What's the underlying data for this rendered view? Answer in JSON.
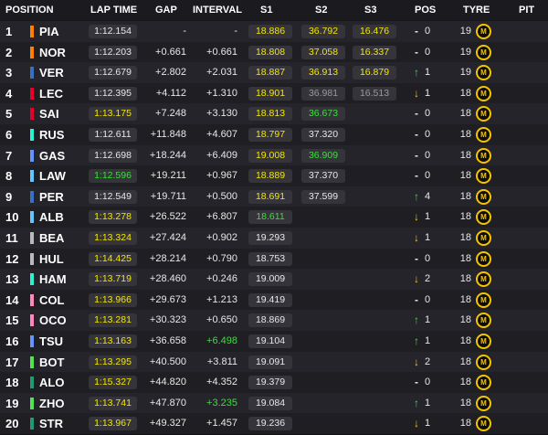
{
  "header": {
    "position": "POSITION",
    "lap_time": "LAP TIME",
    "gap": "GAP",
    "interval": "INTERVAL",
    "s1": "S1",
    "s2": "S2",
    "s3": "S3",
    "pos": "POS",
    "tyre": "TYRE",
    "pit": "PIT"
  },
  "colors": {
    "mclaren": "#ff8000",
    "redbull": "#3671c6",
    "ferrari": "#e8002d",
    "mercedes": "#27f4d2",
    "alpine": "#ff87bc",
    "williams": "#64c4ff",
    "haas": "#b6babd",
    "rb": "#6692ff",
    "sauber": "#52e252",
    "aston": "#229971",
    "personal_best": "#f5e600",
    "overall_best": "#38e038",
    "tyre_medium": "#f5c400"
  },
  "rows": [
    {
      "pos": "1",
      "team": "mclaren",
      "driver": "PIA",
      "lap": "1:12.154",
      "lap_c": "white",
      "gap": "-",
      "interval": "-",
      "int_c": "white",
      "s1": "18.886",
      "s1_c": "yellow",
      "s2": "36.792",
      "s2_c": "yellow",
      "s3": "16.476",
      "s3_c": "yellow",
      "arrow": "",
      "change": "0",
      "tyre_age": "19",
      "tyre": "M"
    },
    {
      "pos": "2",
      "team": "mclaren",
      "driver": "NOR",
      "lap": "1:12.203",
      "lap_c": "white",
      "gap": "+0.661",
      "interval": "+0.661",
      "int_c": "white",
      "s1": "18.808",
      "s1_c": "yellow",
      "s2": "37.058",
      "s2_c": "yellow",
      "s3": "16.337",
      "s3_c": "yellow",
      "arrow": "",
      "change": "0",
      "tyre_age": "19",
      "tyre": "M"
    },
    {
      "pos": "3",
      "team": "redbull",
      "driver": "VER",
      "lap": "1:12.679",
      "lap_c": "white",
      "gap": "+2.802",
      "interval": "+2.031",
      "int_c": "white",
      "s1": "18.887",
      "s1_c": "yellow",
      "s2": "36.913",
      "s2_c": "yellow",
      "s3": "16.879",
      "s3_c": "yellow",
      "arrow": "up",
      "change": "1",
      "tyre_age": "19",
      "tyre": "M"
    },
    {
      "pos": "4",
      "team": "ferrari",
      "driver": "LEC",
      "lap": "1:12.395",
      "lap_c": "white",
      "gap": "+4.112",
      "interval": "+1.310",
      "int_c": "white",
      "s1": "18.901",
      "s1_c": "yellow",
      "s2": "36.981",
      "s2_c": "gray",
      "s3": "16.513",
      "s3_c": "gray",
      "arrow": "down",
      "change": "1",
      "tyre_age": "18",
      "tyre": "M"
    },
    {
      "pos": "5",
      "team": "ferrari",
      "driver": "SAI",
      "lap": "1:13.175",
      "lap_c": "yellow",
      "gap": "+7.248",
      "interval": "+3.130",
      "int_c": "white",
      "s1": "18.813",
      "s1_c": "yellow",
      "s2": "36.673",
      "s2_c": "green",
      "s3": "",
      "s3_c": "gray",
      "arrow": "",
      "change": "0",
      "tyre_age": "18",
      "tyre": "M"
    },
    {
      "pos": "6",
      "team": "mercedes",
      "driver": "RUS",
      "lap": "1:12.611",
      "lap_c": "white",
      "gap": "+11.848",
      "interval": "+4.607",
      "int_c": "white",
      "s1": "18.797",
      "s1_c": "yellow",
      "s2": "37.320",
      "s2_c": "white",
      "s3": "",
      "s3_c": "gray",
      "arrow": "",
      "change": "0",
      "tyre_age": "18",
      "tyre": "M"
    },
    {
      "pos": "7",
      "team": "rb",
      "driver": "GAS",
      "lap": "1:12.698",
      "lap_c": "white",
      "gap": "+18.244",
      "interval": "+6.409",
      "int_c": "white",
      "s1": "19.008",
      "s1_c": "yellow",
      "s2": "36.909",
      "s2_c": "green",
      "s3": "",
      "s3_c": "gray",
      "arrow": "",
      "change": "0",
      "tyre_age": "18",
      "tyre": "M"
    },
    {
      "pos": "8",
      "team": "williams",
      "driver": "LAW",
      "lap": "1:12.596",
      "lap_c": "green",
      "gap": "+19.211",
      "interval": "+0.967",
      "int_c": "white",
      "s1": "18.889",
      "s1_c": "yellow",
      "s2": "37.370",
      "s2_c": "white",
      "s3": "",
      "s3_c": "gray",
      "arrow": "",
      "change": "0",
      "tyre_age": "18",
      "tyre": "M"
    },
    {
      "pos": "9",
      "team": "redbull",
      "driver": "PER",
      "lap": "1:12.549",
      "lap_c": "white",
      "gap": "+19.711",
      "interval": "+0.500",
      "int_c": "white",
      "s1": "18.691",
      "s1_c": "yellow",
      "s2": "37.599",
      "s2_c": "white",
      "s3": "",
      "s3_c": "gray",
      "arrow": "up",
      "change": "4",
      "tyre_age": "18",
      "tyre": "M"
    },
    {
      "pos": "10",
      "team": "williams",
      "driver": "ALB",
      "lap": "1:13.278",
      "lap_c": "yellow",
      "gap": "+26.522",
      "interval": "+6.807",
      "int_c": "white",
      "s1": "18.611",
      "s1_c": "green",
      "s2": "",
      "s2_c": "gray",
      "s3": "",
      "s3_c": "gray",
      "arrow": "down",
      "change": "1",
      "tyre_age": "18",
      "tyre": "M"
    },
    {
      "pos": "11",
      "team": "haas",
      "driver": "BEA",
      "lap": "1:13.324",
      "lap_c": "yellow",
      "gap": "+27.424",
      "interval": "+0.902",
      "int_c": "white",
      "s1": "19.293",
      "s1_c": "white",
      "s2": "",
      "s2_c": "gray",
      "s3": "",
      "s3_c": "gray",
      "arrow": "down",
      "change": "1",
      "tyre_age": "18",
      "tyre": "M"
    },
    {
      "pos": "12",
      "team": "haas",
      "driver": "HUL",
      "lap": "1:14.425",
      "lap_c": "yellow",
      "gap": "+28.214",
      "interval": "+0.790",
      "int_c": "white",
      "s1": "18.753",
      "s1_c": "white",
      "s2": "",
      "s2_c": "gray",
      "s3": "",
      "s3_c": "gray",
      "arrow": "",
      "change": "0",
      "tyre_age": "18",
      "tyre": "M"
    },
    {
      "pos": "13",
      "team": "mercedes",
      "driver": "HAM",
      "lap": "1:13.719",
      "lap_c": "yellow",
      "gap": "+28.460",
      "interval": "+0.246",
      "int_c": "white",
      "s1": "19.009",
      "s1_c": "white",
      "s2": "",
      "s2_c": "gray",
      "s3": "",
      "s3_c": "gray",
      "arrow": "down",
      "change": "2",
      "tyre_age": "18",
      "tyre": "M"
    },
    {
      "pos": "14",
      "team": "alpine",
      "driver": "COL",
      "lap": "1:13.966",
      "lap_c": "yellow",
      "gap": "+29.673",
      "interval": "+1.213",
      "int_c": "white",
      "s1": "19.419",
      "s1_c": "white",
      "s2": "",
      "s2_c": "gray",
      "s3": "",
      "s3_c": "gray",
      "arrow": "",
      "change": "0",
      "tyre_age": "18",
      "tyre": "M"
    },
    {
      "pos": "15",
      "team": "alpine",
      "driver": "OCO",
      "lap": "1:13.281",
      "lap_c": "yellow",
      "gap": "+30.323",
      "interval": "+0.650",
      "int_c": "white",
      "s1": "18.869",
      "s1_c": "white",
      "s2": "",
      "s2_c": "gray",
      "s3": "",
      "s3_c": "gray",
      "arrow": "up",
      "change": "1",
      "tyre_age": "18",
      "tyre": "M"
    },
    {
      "pos": "16",
      "team": "rb",
      "driver": "TSU",
      "lap": "1:13.163",
      "lap_c": "yellow",
      "gap": "+36.658",
      "interval": "+6.498",
      "int_c": "green",
      "s1": "19.104",
      "s1_c": "white",
      "s2": "",
      "s2_c": "gray",
      "s3": "",
      "s3_c": "gray",
      "arrow": "up",
      "change": "1",
      "tyre_age": "18",
      "tyre": "M"
    },
    {
      "pos": "17",
      "team": "sauber",
      "driver": "BOT",
      "lap": "1:13.295",
      "lap_c": "yellow",
      "gap": "+40.500",
      "interval": "+3.811",
      "int_c": "white",
      "s1": "19.091",
      "s1_c": "white",
      "s2": "",
      "s2_c": "gray",
      "s3": "",
      "s3_c": "gray",
      "arrow": "down",
      "change": "2",
      "tyre_age": "18",
      "tyre": "M"
    },
    {
      "pos": "18",
      "team": "aston",
      "driver": "ALO",
      "lap": "1:15.327",
      "lap_c": "yellow",
      "gap": "+44.820",
      "interval": "+4.352",
      "int_c": "white",
      "s1": "19.379",
      "s1_c": "white",
      "s2": "",
      "s2_c": "gray",
      "s3": "",
      "s3_c": "gray",
      "arrow": "",
      "change": "0",
      "tyre_age": "18",
      "tyre": "M"
    },
    {
      "pos": "19",
      "team": "sauber",
      "driver": "ZHO",
      "lap": "1:13.741",
      "lap_c": "yellow",
      "gap": "+47.870",
      "interval": "+3.235",
      "int_c": "green",
      "s1": "19.084",
      "s1_c": "white",
      "s2": "",
      "s2_c": "gray",
      "s3": "",
      "s3_c": "gray",
      "arrow": "up",
      "change": "1",
      "tyre_age": "18",
      "tyre": "M"
    },
    {
      "pos": "20",
      "team": "aston",
      "driver": "STR",
      "lap": "1:13.967",
      "lap_c": "yellow",
      "gap": "+49.327",
      "interval": "+1.457",
      "int_c": "white",
      "s1": "19.236",
      "s1_c": "white",
      "s2": "",
      "s2_c": "gray",
      "s3": "",
      "s3_c": "gray",
      "arrow": "down",
      "change": "1",
      "tyre_age": "18",
      "tyre": "M"
    }
  ]
}
